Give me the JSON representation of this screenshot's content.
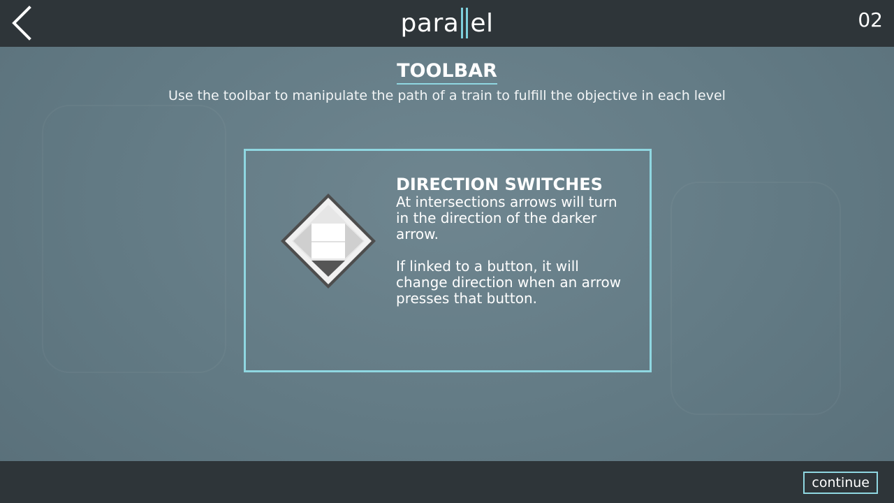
{
  "header": {
    "back_icon": "chevron-left-icon",
    "logo_left": "para",
    "logo_right": "el",
    "level_number": "02"
  },
  "content": {
    "title": "TOOLBAR",
    "subtitle": "Use the toolbar to manipulate the path of a train to fulfill the objective in each level"
  },
  "panel": {
    "icon": "direction-switch-icon",
    "heading": "DIRECTION SWITCHES",
    "paragraphs": [
      "At intersections arrows will turn in the direction of the darker arrow.",
      "If linked to a button, it will change direction when an arrow presses that button."
    ]
  },
  "footer": {
    "continue_label": "continue"
  },
  "colors": {
    "accent": "#8fd7e1",
    "bar": "#2e3539",
    "background": "#627a84"
  }
}
